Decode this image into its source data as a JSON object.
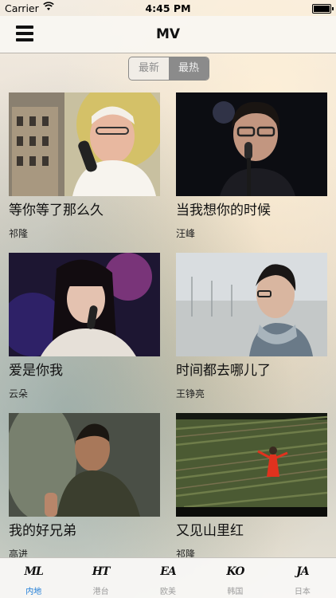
{
  "status_bar": {
    "carrier": "Carrier",
    "time": "4:45 PM"
  },
  "nav": {
    "title": "MV"
  },
  "segment": {
    "items": [
      "最新",
      "最热"
    ],
    "selected": "最热"
  },
  "videos": [
    {
      "title": "等你等了那么久",
      "artist": "祁隆"
    },
    {
      "title": "当我想你的时候",
      "artist": "汪峰"
    },
    {
      "title": "爱是你我",
      "artist": "云朵"
    },
    {
      "title": "时间都去哪儿了",
      "artist": "王铮亮"
    },
    {
      "title": "我的好兄弟",
      "artist": "高进"
    },
    {
      "title": "又见山里红",
      "artist": "祁隆"
    }
  ],
  "tabbar": {
    "selected": "内地",
    "tabs": [
      {
        "icon_text": "ML",
        "label": "内地"
      },
      {
        "icon_text": "HT",
        "label": "港台"
      },
      {
        "icon_text": "EA",
        "label": "欧美"
      },
      {
        "icon_text": "KO",
        "label": "韩国"
      },
      {
        "icon_text": "JA",
        "label": "日本"
      }
    ]
  },
  "colors": {
    "tab_active": "#1a7ad6",
    "segment_active": "#8b8b8b"
  },
  "icons": [
    "wifi-icon",
    "battery-icon",
    "menu-icon"
  ]
}
